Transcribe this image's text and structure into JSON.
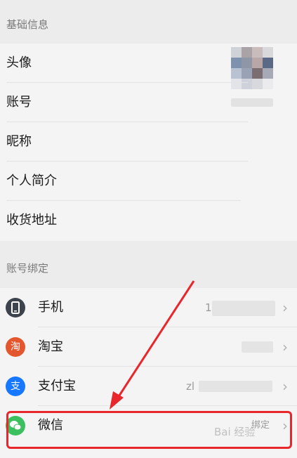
{
  "basic_info": {
    "header": "基础信息",
    "rows": [
      {
        "label": "头像"
      },
      {
        "label": "账号"
      },
      {
        "label": "昵称"
      },
      {
        "label": "个人简介"
      },
      {
        "label": "收货地址"
      }
    ]
  },
  "bindings": {
    "header": "账号绑定",
    "rows": [
      {
        "label": "手机",
        "value": "1",
        "icon": "phone-icon",
        "icon_color": "#3c434c"
      },
      {
        "label": "淘宝",
        "value": "",
        "icon": "taobao-icon",
        "icon_char": "淘",
        "icon_color": "#e4572e"
      },
      {
        "label": "支付宝",
        "value": "zl",
        "icon": "alipay-icon",
        "icon_char": "支",
        "icon_color": "#1677ff"
      },
      {
        "label": "微信",
        "value": "绑定",
        "icon": "wechat-icon",
        "icon_color": "#3cbf5e"
      }
    ]
  },
  "annotation": {
    "highlight_color": "#e8262b"
  },
  "watermark": "Bai 经验"
}
